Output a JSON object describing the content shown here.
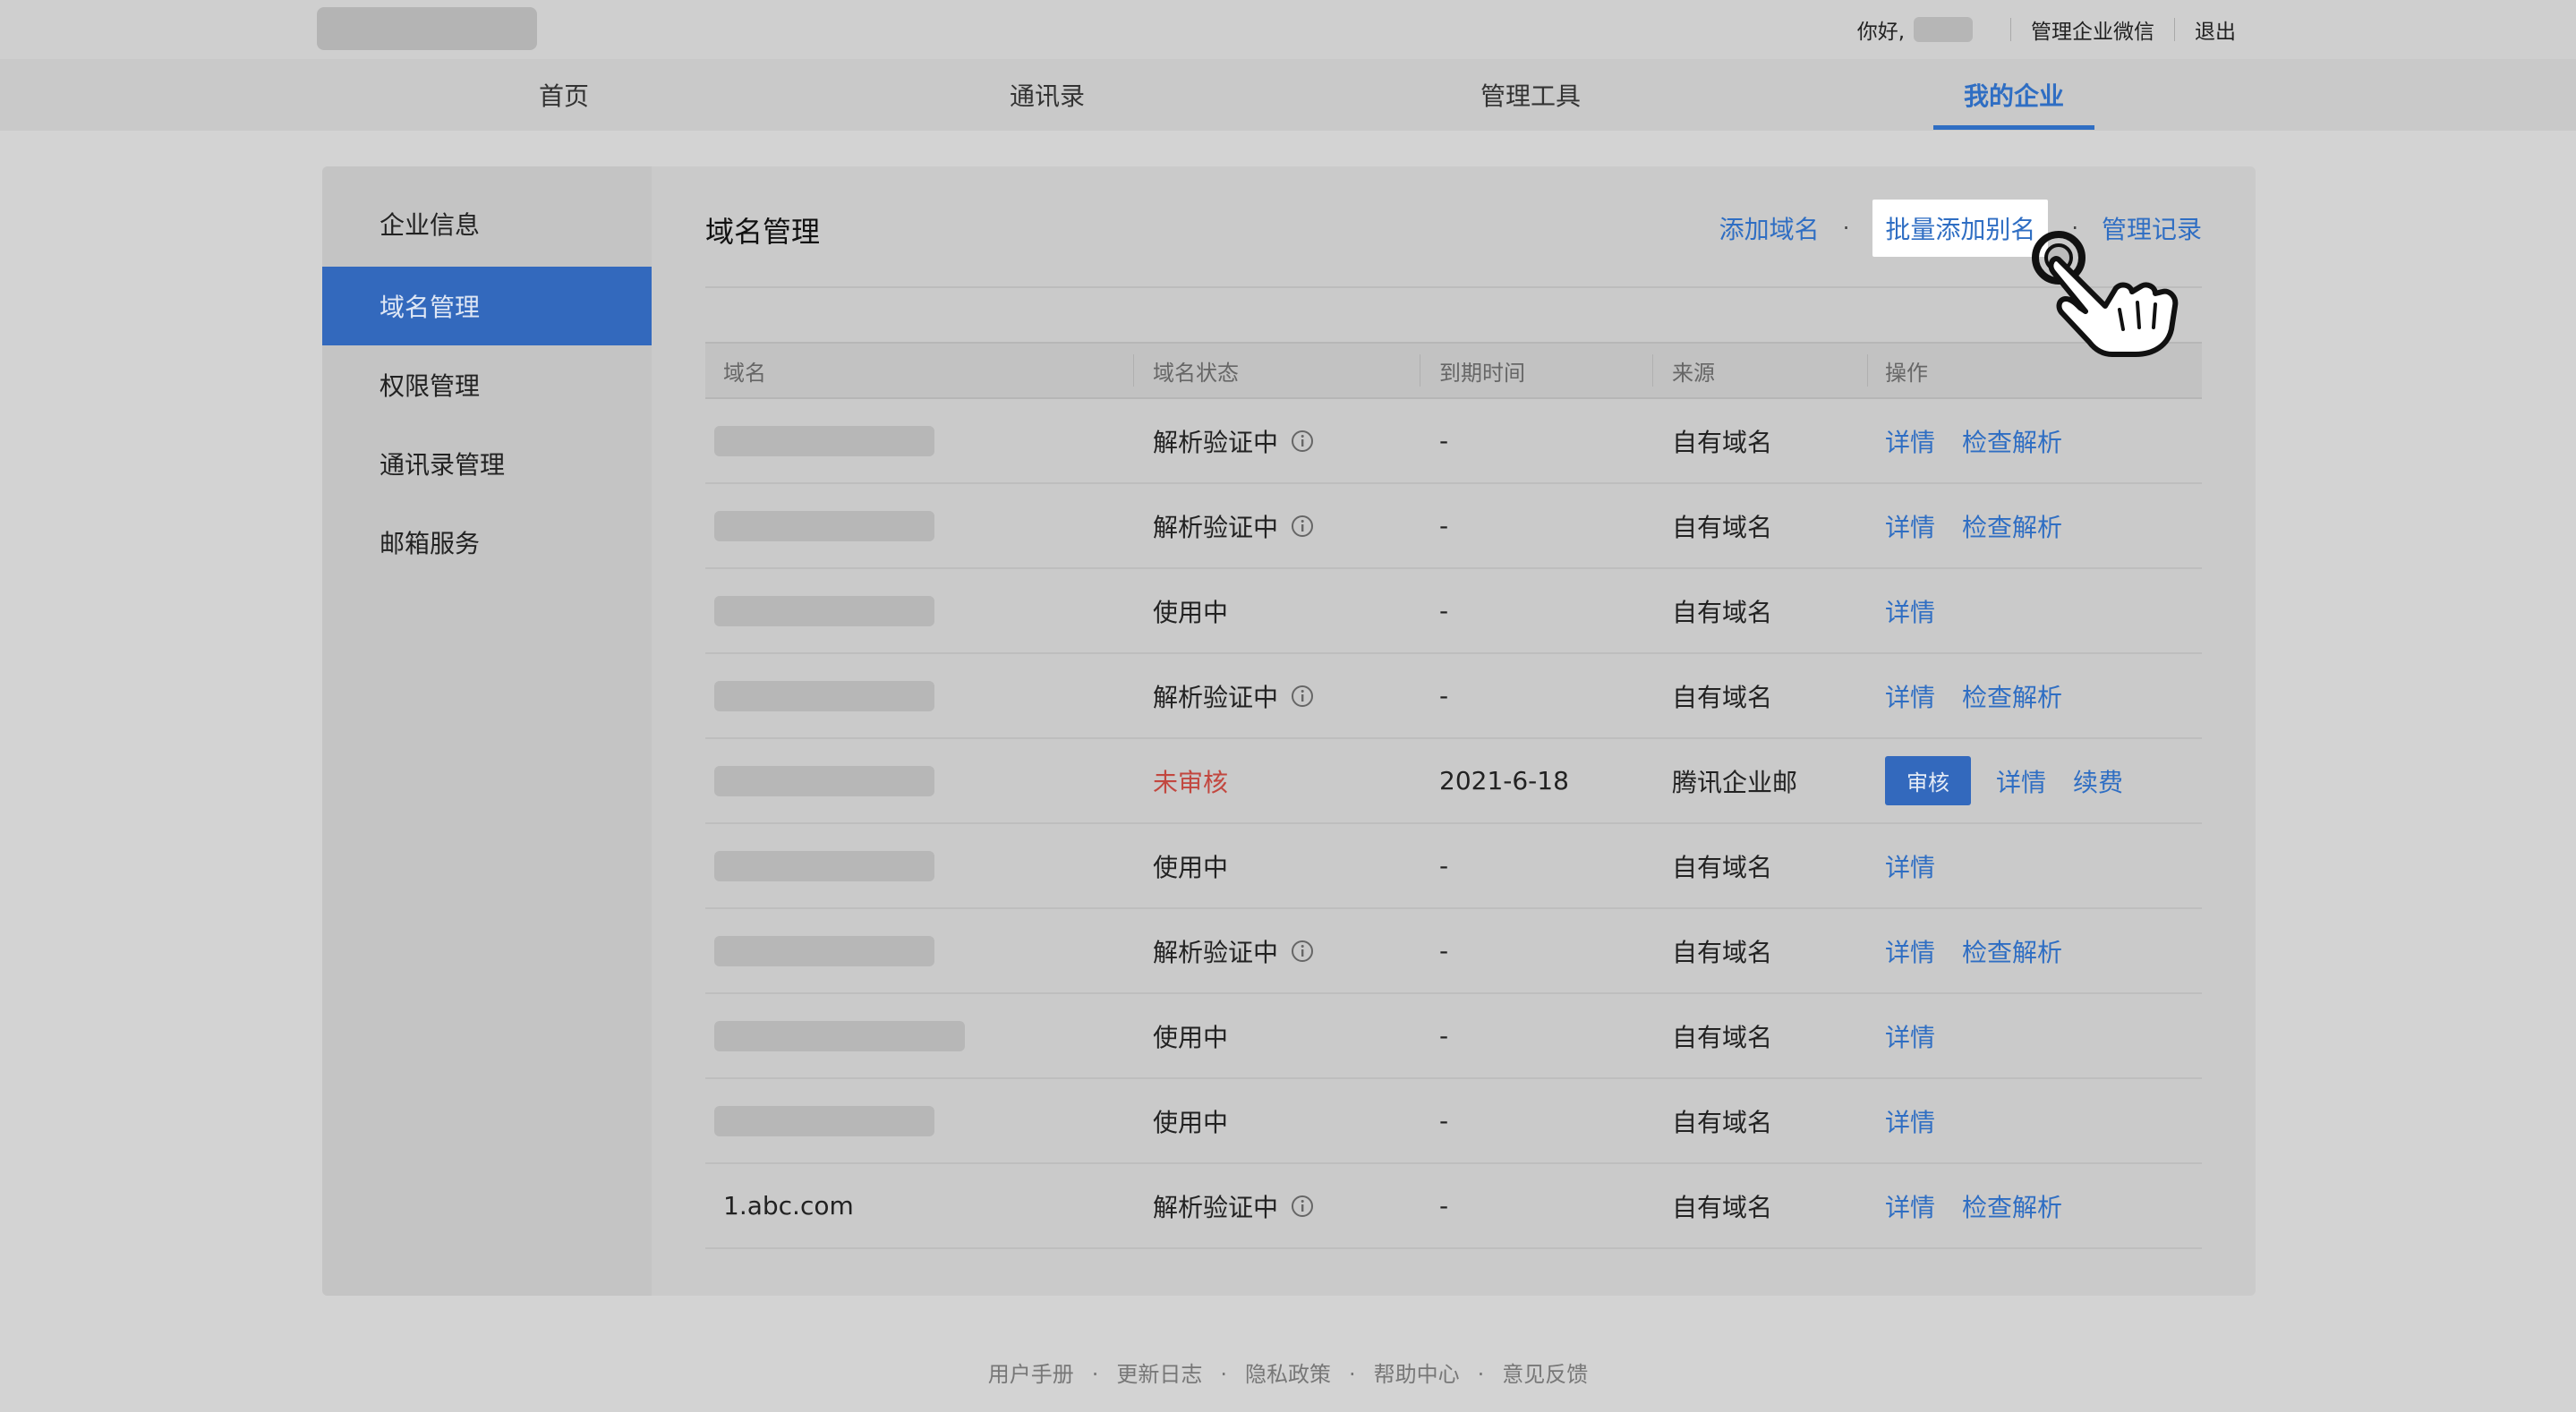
{
  "topbar": {
    "hello": "你好,",
    "admin_link": "管理企业微信",
    "logout": "退出"
  },
  "nav": [
    "首页",
    "通讯录",
    "管理工具",
    "我的企业"
  ],
  "sidebar": [
    "企业信息",
    "域名管理",
    "权限管理",
    "通讯录管理",
    "邮箱服务"
  ],
  "page": {
    "title": "域名管理",
    "actions": [
      "添加域名",
      "批量添加别名",
      "管理记录"
    ],
    "action_dot": "·"
  },
  "table": {
    "headers": [
      "域名",
      "域名状态",
      "到期时间",
      "来源",
      "操作"
    ],
    "rows": [
      {
        "domain": "",
        "status": "解析验证中",
        "expiry": "-",
        "source": "自有域名",
        "ops": [
          "详情",
          "检查解析"
        ]
      },
      {
        "domain": "",
        "status": "解析验证中",
        "expiry": "-",
        "source": "自有域名",
        "ops": [
          "详情",
          "检查解析"
        ]
      },
      {
        "domain": "",
        "status": "使用中",
        "expiry": "-",
        "source": "自有域名",
        "ops": [
          "详情"
        ]
      },
      {
        "domain": "",
        "status": "解析验证中",
        "expiry": "-",
        "source": "自有域名",
        "ops": [
          "详情",
          "检查解析"
        ]
      },
      {
        "domain": "",
        "status": "未审核",
        "expiry": "2021-6-18",
        "source": "腾讯企业邮",
        "review": "审核",
        "ops": [
          "详情",
          "续费"
        ]
      },
      {
        "domain": "",
        "status": "使用中",
        "expiry": "-",
        "source": "自有域名",
        "ops": [
          "详情"
        ]
      },
      {
        "domain": "",
        "status": "解析验证中",
        "expiry": "-",
        "source": "自有域名",
        "ops": [
          "详情",
          "检查解析"
        ]
      },
      {
        "domain": "",
        "status": "使用中",
        "expiry": "-",
        "source": "自有域名",
        "ops": [
          "详情"
        ]
      },
      {
        "domain": "",
        "status": "使用中",
        "expiry": "-",
        "source": "自有域名",
        "ops": [
          "详情"
        ]
      },
      {
        "domain": "1.abc.com",
        "status": "解析验证中",
        "expiry": "-",
        "source": "自有域名",
        "ops": [
          "详情",
          "检查解析"
        ]
      }
    ]
  },
  "footer": [
    "用户手册",
    "·",
    "更新日志",
    "·",
    "隐私政策",
    "·",
    "帮助中心",
    "·",
    "意见反馈"
  ],
  "colors": {
    "accent": "#2f6ec3",
    "active_bg": "#3369bd",
    "warning": "#c2473f"
  },
  "icons": {
    "status_info": "info-icon",
    "cursor": "pointing-hand-icon"
  }
}
